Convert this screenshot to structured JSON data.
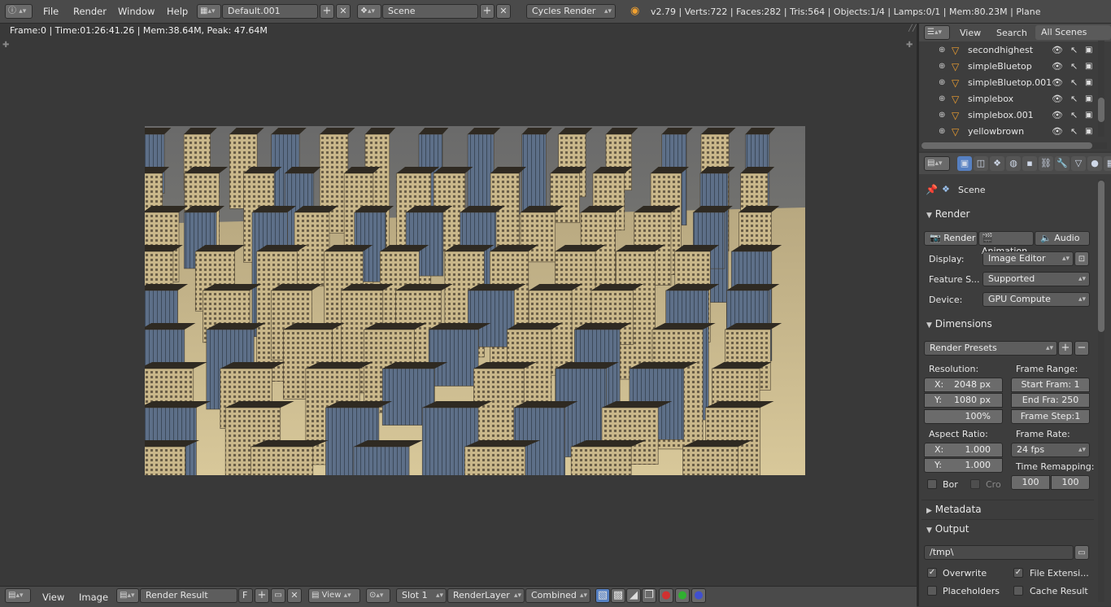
{
  "topbar": {
    "menus": [
      "File",
      "Render",
      "Window",
      "Help"
    ],
    "screen_layout": "Default.001",
    "scene": "Scene",
    "engine": "Cycles Render",
    "stats": "v2.79 | Verts:722 | Faces:282 | Tris:564 | Objects:1/4 | Lamps:0/1 | Mem:80.23M | Plane"
  },
  "image_editor": {
    "status": "Frame:0 | Time:01:26:41.26 | Mem:38.64M, Peak: 47.64M"
  },
  "bottombar": {
    "menus": [
      "View",
      "Image"
    ],
    "image_name": "Render Result",
    "fake_user": "F",
    "view_label": "View",
    "slot": "Slot 1",
    "render_layer": "RenderLayer",
    "pass": "Combined"
  },
  "outliner": {
    "tabs": [
      "View",
      "Search",
      "All Scenes"
    ],
    "items": [
      {
        "label": "secondhighest"
      },
      {
        "label": "simpleBluetop"
      },
      {
        "label": "simpleBluetop.001"
      },
      {
        "label": "simplebox"
      },
      {
        "label": "simplebox.001"
      },
      {
        "label": "yellowbrown"
      }
    ]
  },
  "properties": {
    "breadcrumb": "Scene",
    "render_panel": {
      "title": "Render",
      "buttons": [
        "Render",
        "Animation",
        "Audio"
      ],
      "display_label": "Display:",
      "display_value": "Image Editor",
      "feature_label": "Feature S...",
      "feature_value": "Supported",
      "device_label": "Device:",
      "device_value": "GPU Compute"
    },
    "dimensions_panel": {
      "title": "Dimensions",
      "presets": "Render Presets",
      "resolution_label": "Resolution:",
      "res_x": "X:",
      "res_x_value": "2048 px",
      "res_y": "Y:",
      "res_y_value": "1080 px",
      "res_pct": "100%",
      "frame_range_label": "Frame Range:",
      "start_frame": "Start Fram:",
      "start_frame_value": "1",
      "end_frame": "End Fra:",
      "end_frame_value": "250",
      "frame_step": "Frame Step:",
      "frame_step_value": "1",
      "aspect_label": "Aspect Ratio:",
      "aspect_x": "X:",
      "aspect_x_value": "1.000",
      "aspect_y": "Y:",
      "aspect_y_value": "1.000",
      "frame_rate_label": "Frame Rate:",
      "frame_rate_value": "24 fps",
      "time_remap_label": "Time Remapping:",
      "remap_old": "100",
      "remap_new": "100",
      "border_label": "Bor",
      "crop_label": "Cro"
    },
    "metadata_panel": {
      "title": "Metadata"
    },
    "output_panel": {
      "title": "Output",
      "path": "/tmp\\",
      "overwrite": "Overwrite",
      "file_ext": "File Extensi...",
      "placeholders": "Placeholders",
      "cache_result": "Cache Result"
    }
  }
}
